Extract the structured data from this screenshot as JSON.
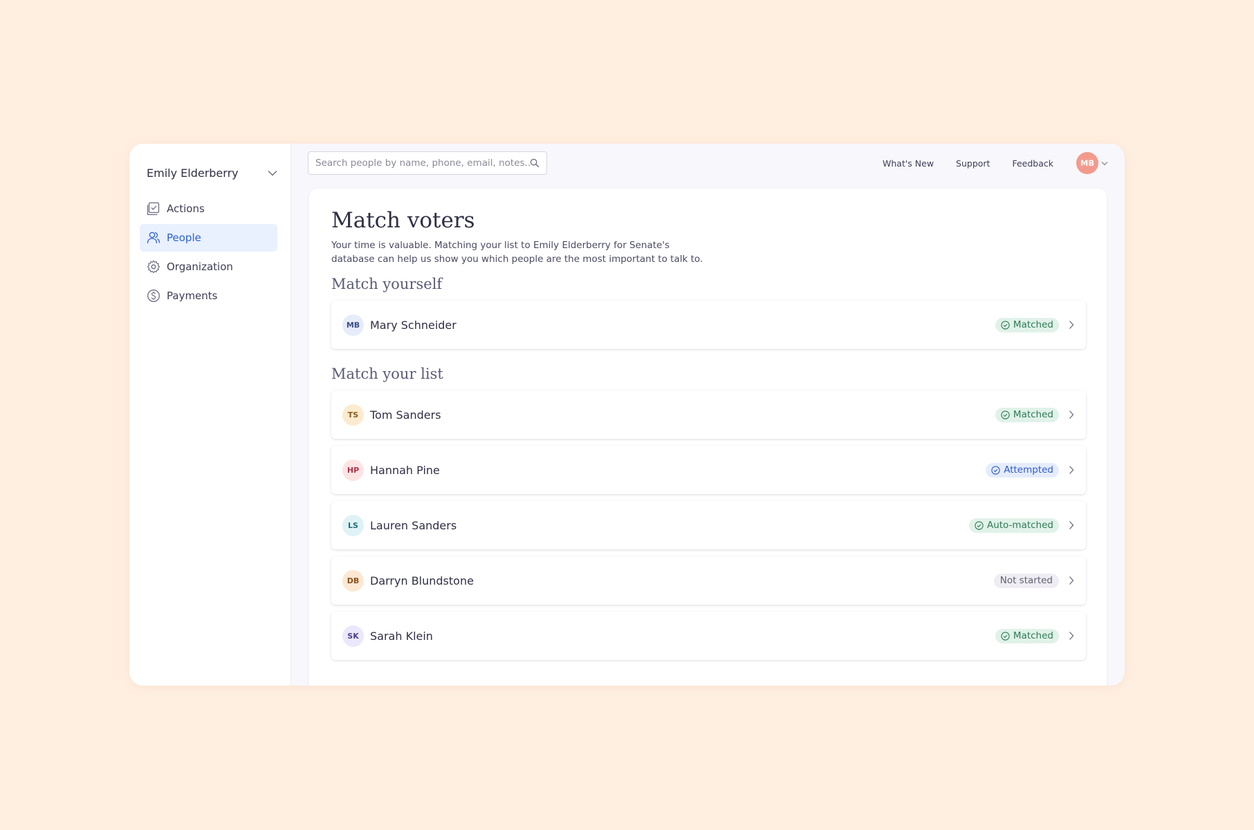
{
  "sidebar": {
    "org_name": "Emily Elderberry",
    "nav": [
      {
        "label": "Actions",
        "icon": "actions-icon",
        "active": false
      },
      {
        "label": "People",
        "icon": "people-icon",
        "active": true
      },
      {
        "label": "Organization",
        "icon": "gear-icon",
        "active": false
      },
      {
        "label": "Payments",
        "icon": "dollar-icon",
        "active": false
      }
    ]
  },
  "topbar": {
    "search_placeholder": "Search people by name, phone, email, notes...",
    "search_value": "",
    "links": [
      "What's New",
      "Support",
      "Feedback"
    ],
    "user_initials": "MB",
    "user_avatar_color": "#f29a8c"
  },
  "main": {
    "title": "Match voters",
    "description": "Your time is valuable. Matching your list to Emily Elderberry for Senate's database can help us show you which people are the most important to talk to.",
    "match_yourself": {
      "title": "Match yourself",
      "person": {
        "initials": "MB",
        "name": "Mary Schneider",
        "status": "Matched",
        "status_type": "matched",
        "avatar_bg": "#e7ecfb",
        "avatar_fg": "#3c4f86"
      }
    },
    "match_list": {
      "title": "Match your list",
      "people": [
        {
          "initials": "TS",
          "name": "Tom Sanders",
          "status": "Matched",
          "status_type": "matched",
          "avatar_bg": "#fdebcf",
          "avatar_fg": "#8a5a17"
        },
        {
          "initials": "HP",
          "name": "Hannah Pine",
          "status": "Attempted",
          "status_type": "attempted",
          "avatar_bg": "#fde4e4",
          "avatar_fg": "#b0344a"
        },
        {
          "initials": "LS",
          "name": "Lauren Sanders",
          "status": "Auto-matched",
          "status_type": "matched",
          "avatar_bg": "#dff3f6",
          "avatar_fg": "#226c78"
        },
        {
          "initials": "DB",
          "name": "Darryn Blundstone",
          "status": "Not started",
          "status_type": "notstarted",
          "avatar_bg": "#fde8d3",
          "avatar_fg": "#8a4e1b"
        },
        {
          "initials": "SK",
          "name": "Sarah Klein",
          "status": "Matched",
          "status_type": "matched",
          "avatar_bg": "#ece8fb",
          "avatar_fg": "#4d3f8e"
        }
      ]
    }
  }
}
